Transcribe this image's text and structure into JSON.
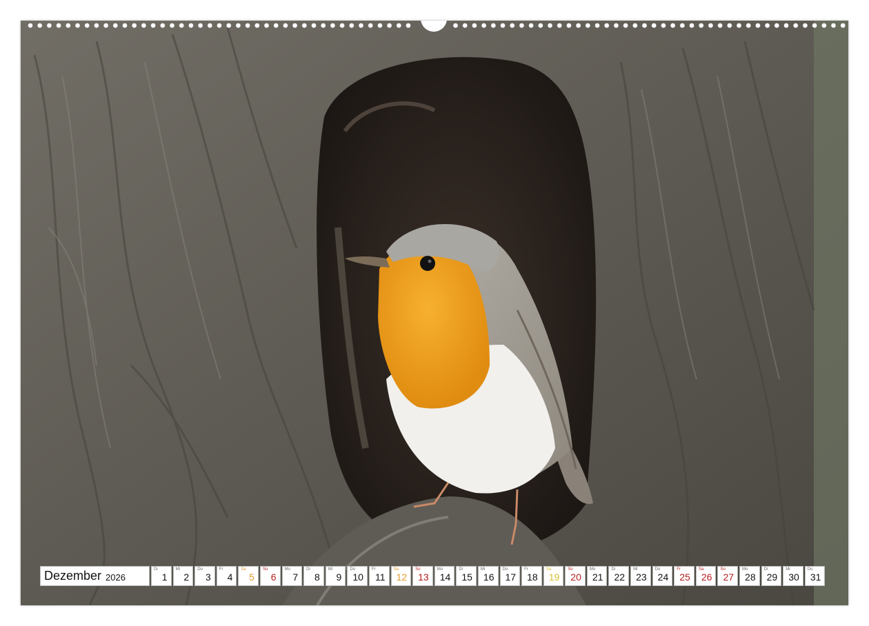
{
  "calendar": {
    "month": "Dezember",
    "year": "2026",
    "days": [
      {
        "wd": "Di",
        "n": "1",
        "kind": "weekday"
      },
      {
        "wd": "Mi",
        "n": "2",
        "kind": "weekday"
      },
      {
        "wd": "Do",
        "n": "3",
        "kind": "weekday"
      },
      {
        "wd": "Fr",
        "n": "4",
        "kind": "weekday"
      },
      {
        "wd": "Sa",
        "n": "5",
        "kind": "sat"
      },
      {
        "wd": "So",
        "n": "6",
        "kind": "sun"
      },
      {
        "wd": "Mo",
        "n": "7",
        "kind": "weekday"
      },
      {
        "wd": "Di",
        "n": "8",
        "kind": "weekday"
      },
      {
        "wd": "Mi",
        "n": "9",
        "kind": "weekday"
      },
      {
        "wd": "Do",
        "n": "10",
        "kind": "weekday"
      },
      {
        "wd": "Fr",
        "n": "11",
        "kind": "weekday"
      },
      {
        "wd": "Sa",
        "n": "12",
        "kind": "sat"
      },
      {
        "wd": "So",
        "n": "13",
        "kind": "sun"
      },
      {
        "wd": "Mo",
        "n": "14",
        "kind": "weekday"
      },
      {
        "wd": "Di",
        "n": "15",
        "kind": "weekday"
      },
      {
        "wd": "Mi",
        "n": "16",
        "kind": "weekday"
      },
      {
        "wd": "Do",
        "n": "17",
        "kind": "weekday"
      },
      {
        "wd": "Fr",
        "n": "18",
        "kind": "weekday"
      },
      {
        "wd": "Sa",
        "n": "19",
        "kind": "sat2"
      },
      {
        "wd": "So",
        "n": "20",
        "kind": "sun"
      },
      {
        "wd": "Mo",
        "n": "21",
        "kind": "weekday"
      },
      {
        "wd": "Di",
        "n": "22",
        "kind": "weekday"
      },
      {
        "wd": "Mi",
        "n": "23",
        "kind": "weekday"
      },
      {
        "wd": "Do",
        "n": "24",
        "kind": "weekday"
      },
      {
        "wd": "Fr",
        "n": "25",
        "kind": "hol"
      },
      {
        "wd": "Sa",
        "n": "26",
        "kind": "hol"
      },
      {
        "wd": "So",
        "n": "27",
        "kind": "sun"
      },
      {
        "wd": "Mo",
        "n": "28",
        "kind": "weekday"
      },
      {
        "wd": "Di",
        "n": "29",
        "kind": "weekday"
      },
      {
        "wd": "Mi",
        "n": "30",
        "kind": "weekday"
      },
      {
        "wd": "Do",
        "n": "31",
        "kind": "weekday"
      }
    ]
  },
  "photo": {
    "bark_color": "#6b6860",
    "hollow_color": "#2a2420",
    "breast_color": "#f0a020",
    "belly_color": "#f2f2f0",
    "back_color": "#a8a49a"
  }
}
